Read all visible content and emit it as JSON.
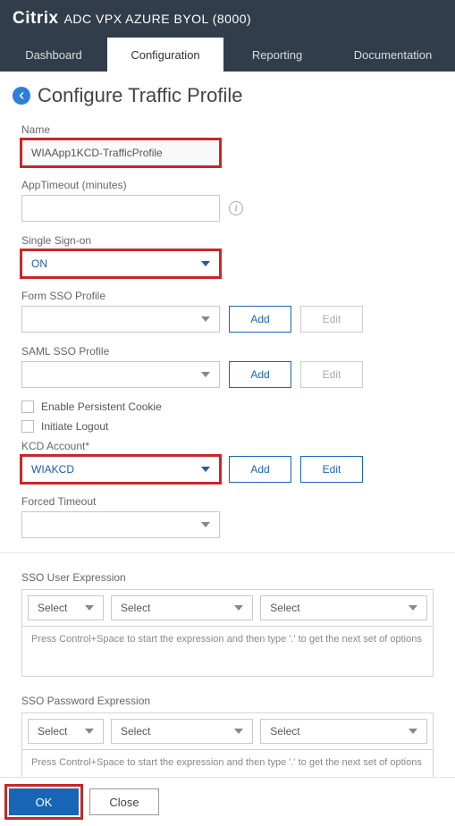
{
  "header": {
    "brand": "Citrix",
    "product": "ADC VPX AZURE BYOL (8000)"
  },
  "tabs": [
    "Dashboard",
    "Configuration",
    "Reporting",
    "Documentation"
  ],
  "active_tab_index": 1,
  "page_title": "Configure Traffic Profile",
  "fields": {
    "name": {
      "label": "Name",
      "value": "WIAApp1KCD-TrafficProfile"
    },
    "app_timeout": {
      "label": "AppTimeout (minutes)",
      "value": ""
    },
    "sso": {
      "label": "Single Sign-on",
      "value": "ON"
    },
    "form_sso": {
      "label": "Form SSO Profile",
      "value": "",
      "add": "Add",
      "edit": "Edit"
    },
    "saml_sso": {
      "label": "SAML SSO Profile",
      "value": "",
      "add": "Add",
      "edit": "Edit"
    },
    "persistent_cookie": {
      "label": "Enable Persistent Cookie",
      "checked": false
    },
    "initiate_logout": {
      "label": "Initiate Logout",
      "checked": false
    },
    "kcd_account": {
      "label": "KCD Account*",
      "value": "WIAKCD",
      "add": "Add",
      "edit": "Edit"
    },
    "forced_timeout": {
      "label": "Forced Timeout",
      "value": ""
    }
  },
  "expr": {
    "user": {
      "label": "SSO User Expression",
      "selects": [
        "Select",
        "Select",
        "Select"
      ],
      "hint": "Press Control+Space to start the expression and then type '.' to get the next set of options"
    },
    "password": {
      "label": "SSO Password Expression",
      "selects": [
        "Select",
        "Select",
        "Select"
      ],
      "hint": "Press Control+Space to start the expression and then type '.' to get the next set of options"
    }
  },
  "footer": {
    "ok": "OK",
    "close": "Close"
  }
}
